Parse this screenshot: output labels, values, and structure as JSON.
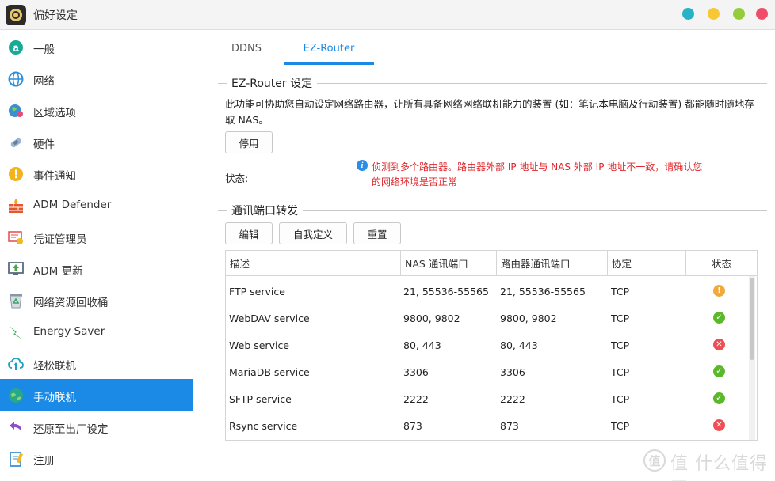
{
  "window": {
    "title": "偏好设定"
  },
  "colors": {
    "accent": "#1a8ae6",
    "warning_text": "#e0262b",
    "status_ok": "#5cb82b",
    "status_warn": "#f2a93b",
    "status_error": "#ef4f54"
  },
  "sidebar": {
    "items": [
      {
        "label": "一般",
        "icon": "general-a-icon"
      },
      {
        "label": "网络",
        "icon": "globe-icon"
      },
      {
        "label": "区域选项",
        "icon": "region-globe-icon"
      },
      {
        "label": "硬件",
        "icon": "hardware-icon"
      },
      {
        "label": "事件通知",
        "icon": "alert-icon"
      },
      {
        "label": "ADM Defender",
        "icon": "firewall-icon"
      },
      {
        "label": "凭证管理员",
        "icon": "certificate-icon"
      },
      {
        "label": "ADM 更新",
        "icon": "update-icon"
      },
      {
        "label": "网络资源回收桶",
        "icon": "recycle-bin-icon"
      },
      {
        "label": "Energy Saver",
        "icon": "energy-icon"
      },
      {
        "label": "轻松联机",
        "icon": "cloud-upload-icon"
      },
      {
        "label": "手动联机",
        "icon": "manual-connect-icon"
      },
      {
        "label": "还原至出厂设定",
        "icon": "restore-icon"
      },
      {
        "label": "注册",
        "icon": "register-icon"
      }
    ]
  },
  "tabs": [
    {
      "label": "DDNS"
    },
    {
      "label": "EZ-Router"
    }
  ],
  "ez_router": {
    "section_title": "EZ-Router 设定",
    "description": "此功能可协助您自动设定网络路由器，让所有具备网络网络联机能力的装置 (如：笔记本电脑及行动装置) 都能随时随地存取 NAS。",
    "disable_button": "停用",
    "status_label": "状态:",
    "status_message": "侦测到多个路由器。路由器外部 IP 地址与 NAS 外部 IP 地址不一致，请确认您的网络环境是否正常"
  },
  "port_forwarding": {
    "section_title": "通讯端口转发",
    "buttons": {
      "edit": "编辑",
      "custom": "自我定义",
      "reset": "重置"
    },
    "columns": {
      "desc": "描述",
      "nas_port": "NAS 通讯端口",
      "router_port": "路由器通讯端口",
      "protocol": "协定",
      "status": "状态"
    },
    "rows": [
      {
        "desc": "FTP service",
        "nas_port": "21, 55536-55565",
        "router_port": "21, 55536-55565",
        "protocol": "TCP",
        "status": "warning"
      },
      {
        "desc": "WebDAV service",
        "nas_port": "9800, 9802",
        "router_port": "9800, 9802",
        "protocol": "TCP",
        "status": "ok"
      },
      {
        "desc": "Web service",
        "nas_port": "80, 443",
        "router_port": "80, 443",
        "protocol": "TCP",
        "status": "error"
      },
      {
        "desc": "MariaDB service",
        "nas_port": "3306",
        "router_port": "3306",
        "protocol": "TCP",
        "status": "ok"
      },
      {
        "desc": "SFTP service",
        "nas_port": "2222",
        "router_port": "2222",
        "protocol": "TCP",
        "status": "ok"
      },
      {
        "desc": "Rsync service",
        "nas_port": "873",
        "router_port": "873",
        "protocol": "TCP",
        "status": "error"
      }
    ]
  },
  "watermark": {
    "text": "值 什么值得买"
  }
}
